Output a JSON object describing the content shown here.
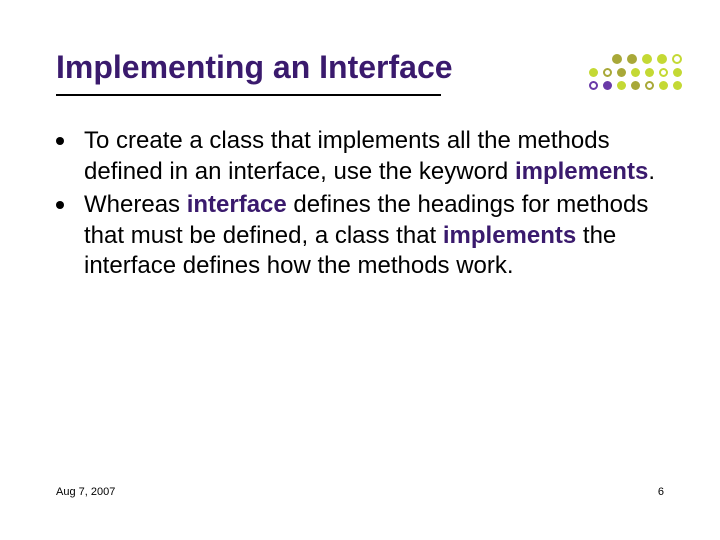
{
  "title": "Implementing an Interface",
  "bullets": [
    {
      "pre": "To create a class that implements all the methods defined in an interface, use the keyword ",
      "kw1": "implements",
      "post1": "."
    },
    {
      "pre": "Whereas ",
      "kw1": "interface",
      "mid": " defines the headings for methods that must be defined, a class that ",
      "kw2": "implements",
      "post2": " the interface defines how the methods work."
    }
  ],
  "footer": {
    "date": "Aug 7, 2007",
    "page": "6"
  },
  "decor": {
    "colors": {
      "olive": "#a8a838",
      "lime": "#c4d934",
      "purple": "#6a3aa8"
    }
  }
}
